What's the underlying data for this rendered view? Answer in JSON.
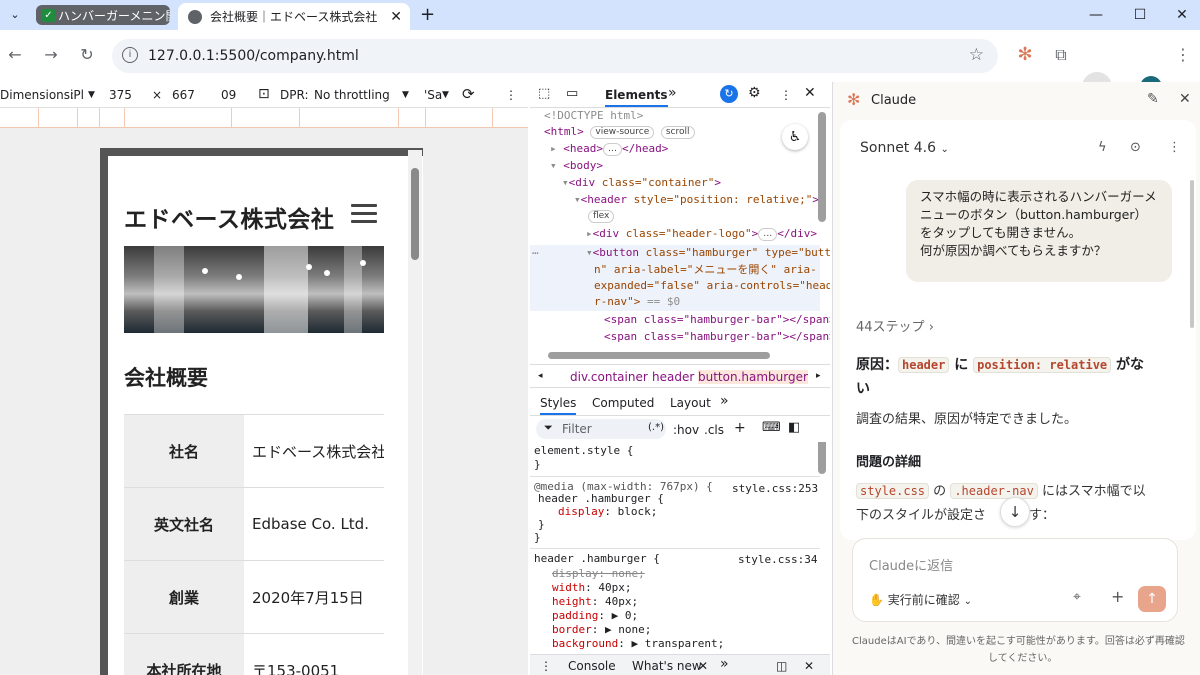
{
  "browser": {
    "tab_group_label": "ハンバーガーメニン開か",
    "active_tab_title": "会社概要｜エドベース株式会社",
    "url": "127.0.0.1:5500/company.html"
  },
  "device_toolbar": {
    "dimensions_label": "Dimensions:",
    "device": "iPl",
    "width": "375",
    "times": "×",
    "height": "667",
    "zoom": "09",
    "dpr_label": "DPR:",
    "throttling": "No throttling",
    "extra": "'Sa"
  },
  "site": {
    "title": "エドベース株式会社",
    "section_title": "会社概要",
    "rows": [
      {
        "key": "社名",
        "value": "エドベース株式会社"
      },
      {
        "key": "英文社名",
        "value": "Edbase Co. Ltd."
      },
      {
        "key": "創業",
        "value": "2020年7月15日"
      },
      {
        "key": "本社所在地",
        "value": "〒153-0051"
      }
    ]
  },
  "devtools": {
    "tabs": {
      "elements": "Elements",
      "more": "»"
    },
    "dom": {
      "doctype": "<!DOCTYPE html>",
      "html_open": "<html>",
      "view_source": "view-source",
      "scroll": "scroll",
      "head": "<head>",
      "head_close": "</head>",
      "ellipsis": "…",
      "body": "<body>",
      "container": "class=\"container\"",
      "header_style": "style=\"position: relative;\"",
      "flex": "flex",
      "header_logo": "class=\"header-logo\"",
      "btn_line1a": "class=\"hamburger\"",
      "btn_line1b": "type=\"butto",
      "btn_line2a": "n\"",
      "btn_line2b": "aria-label=\"メニューを開く\"",
      "btn_line2c": "aria-",
      "btn_line3": "expanded=\"false\" aria-controls=\"heade",
      "btn_line4": "r-nav\">",
      "eq": "== $0",
      "span1": "<span class=\"hamburger-bar\"></span>",
      "span2": "<span class=\"hamburger-bar\"></span>"
    },
    "breadcrumbs": [
      "div.container",
      "header",
      "button.hamburger"
    ],
    "style_tabs": [
      "Styles",
      "Computed",
      "Layout"
    ],
    "filter_placeholder": "Filter",
    "filter_tools": [
      ":hov",
      ".cls"
    ],
    "styles": {
      "element_style": "element.style {",
      "close": "}",
      "media": "@media (max-width: 767px) {",
      "media_src": "style.css:253",
      "media_selector": "header .hamburger {",
      "display_block": "display",
      "display_block_val": "block;",
      "rule_selector": "header .hamburger {",
      "rule_src": "style.css:34",
      "p_display": "display: none;",
      "p_width": "width",
      "p_width_val": "40px;",
      "p_height": "height",
      "p_height_val": "40px;",
      "p_padding": "padding",
      "p_padding_val": "▶ 0;",
      "p_border": "border",
      "p_border_val": "▶ none;",
      "p_bg": "background",
      "p_bg_val": "▶ transparent;"
    },
    "drawer": {
      "console": "Console",
      "whats_new": "What's new"
    }
  },
  "claude": {
    "title": "Claude",
    "model": "Sonnet 4.6",
    "user_message": "スマホ幅の時に表示されるハンバーガーメニューのボタン（button.hamburger）をタップしても開きません。\n何が原因か調べてもらえますか？",
    "steps": "44ステップ",
    "cause_prefix": "原因：",
    "cause_code1": "header",
    "cause_mid": "に",
    "cause_code2": "position: relative",
    "cause_suffix": "がな",
    "cause_suffix2": "い",
    "result_text": "調査の結果、原因が特定できました。",
    "detail_heading": "問題の詳細",
    "detail_code1": "style.css",
    "detail_no": "の",
    "detail_code2": ".header-nav",
    "detail_text1": "にはスマホ幅で以",
    "detail_text2": "下のスタイルが設定さ",
    "detail_text3": "ます：",
    "reply_placeholder": "Claudeに返信",
    "confirm_mode": "実行前に確認",
    "disclaimer1": "ClaudeはAIであり、間違いを起こす可能性があります。回答は必ず再確認",
    "disclaimer2": "してください。"
  },
  "colors": {
    "tabstrip": "#d3e3fd",
    "accent_claude": "#d97757",
    "send_button": "#e8a58c"
  }
}
